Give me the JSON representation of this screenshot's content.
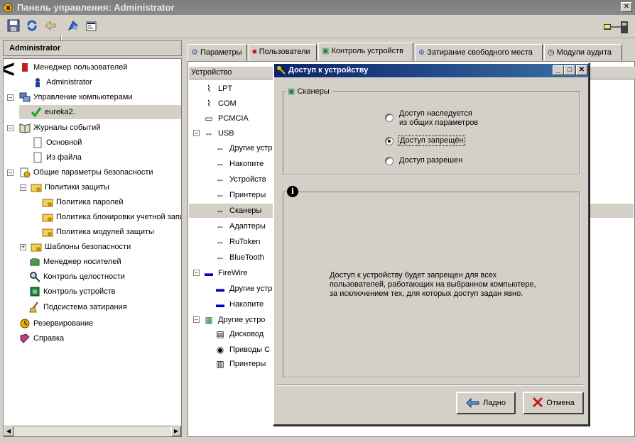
{
  "window": {
    "title": "Панель управления: Administrator"
  },
  "left_panel": {
    "header": "Administrator",
    "tree": [
      {
        "label": "Менеджер пользователей"
      },
      {
        "label": "Administrator"
      },
      {
        "label": "Управление компьютерами"
      },
      {
        "label": "eureka2."
      },
      {
        "label": "Журналы событий"
      },
      {
        "label": "Основной"
      },
      {
        "label": "Из файла"
      },
      {
        "label": "Общие параметры безопасности"
      },
      {
        "label": "Политики защиты"
      },
      {
        "label": "Политика паролей"
      },
      {
        "label": "Политика блокировки учетной запи"
      },
      {
        "label": "Политика модулей защиты"
      },
      {
        "label": "Шаблоны безопасности"
      },
      {
        "label": "Менеджер носителей"
      },
      {
        "label": "Контроль целостности"
      },
      {
        "label": "Контроль устройств"
      },
      {
        "label": "Подсистема затирания"
      },
      {
        "label": "Резервирование"
      },
      {
        "label": "Справка"
      }
    ]
  },
  "tabs": [
    {
      "label": "Параметры"
    },
    {
      "label": "Пользователи"
    },
    {
      "label": "Контроль устройств"
    },
    {
      "label": "Затирание свободного места"
    },
    {
      "label": "Модули аудита"
    }
  ],
  "device_list": {
    "column_header": "Устройство",
    "items": [
      {
        "label": "LPT"
      },
      {
        "label": "COM"
      },
      {
        "label": "PCMCIA"
      },
      {
        "label": "USB"
      },
      {
        "label": "Другие устр"
      },
      {
        "label": "Накопите"
      },
      {
        "label": "Устройств"
      },
      {
        "label": "Принтеры"
      },
      {
        "label": "Сканеры"
      },
      {
        "label": "Адаптеры"
      },
      {
        "label": "RuToken"
      },
      {
        "label": "BlueTooth"
      },
      {
        "label": "FireWire"
      },
      {
        "label": "Другие устр"
      },
      {
        "label": "Накопите"
      },
      {
        "label": "Другие устро"
      },
      {
        "label": "Дисковод"
      },
      {
        "label": "Приводы С"
      },
      {
        "label": "Принтеры"
      }
    ]
  },
  "dialog": {
    "title": "Доступ к устройству",
    "group_label": "Сканеры",
    "options": [
      {
        "label_line1": "Доступ наследуется",
        "label_line2": "из общих параметров",
        "selected": false
      },
      {
        "label_line1": "Доступ запрещён",
        "label_line2": "",
        "selected": true
      },
      {
        "label_line1": "Доступ разрешен",
        "label_line2": "",
        "selected": false
      }
    ],
    "info_text": "Доступ к устройству будет запрещен для всех пользователей, работающих на выбранном компьютере, за исключением тех, для которых доступ задан явно.",
    "ok_label": "Ладно",
    "cancel_label": "Отмена"
  },
  "colors": {
    "title_inactive": "#808080",
    "dialog_title": "#0a246a",
    "selection": "#d4d0c8"
  }
}
